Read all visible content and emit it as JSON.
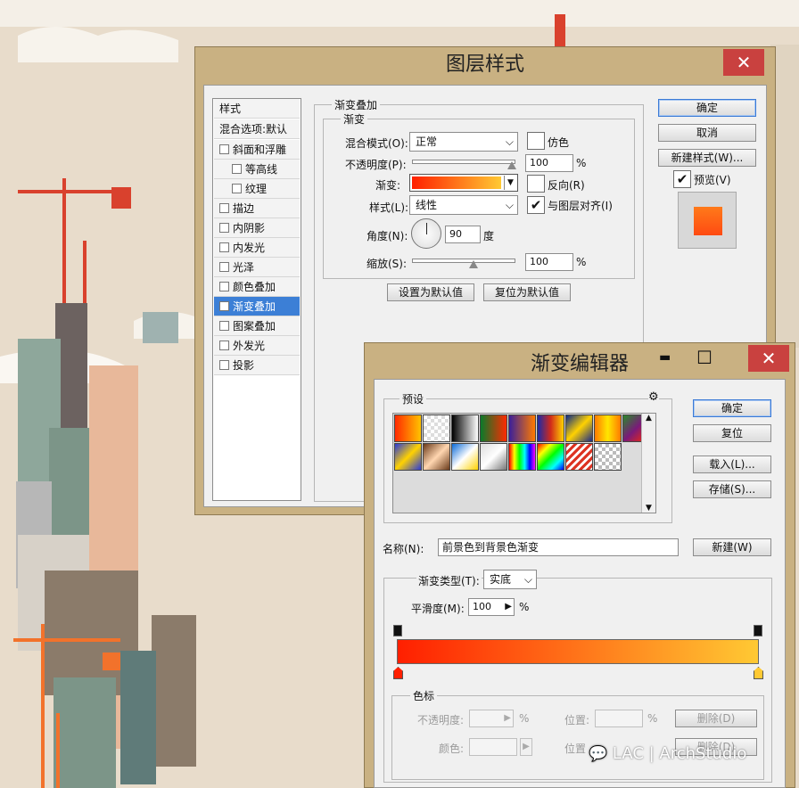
{
  "layer_style": {
    "title": "图层样式",
    "close": "✕",
    "styles_header": "样式",
    "blend_options": "混合选项:默认",
    "items": [
      {
        "label": "斜面和浮雕",
        "checked": false,
        "indent": false
      },
      {
        "label": "等高线",
        "checked": false,
        "indent": true
      },
      {
        "label": "纹理",
        "checked": false,
        "indent": true
      },
      {
        "label": "描边",
        "checked": false,
        "indent": false
      },
      {
        "label": "内阴影",
        "checked": false,
        "indent": false
      },
      {
        "label": "内发光",
        "checked": false,
        "indent": false
      },
      {
        "label": "光泽",
        "checked": false,
        "indent": false
      },
      {
        "label": "颜色叠加",
        "checked": false,
        "indent": false
      },
      {
        "label": "渐变叠加",
        "checked": true,
        "indent": false,
        "selected": true
      },
      {
        "label": "图案叠加",
        "checked": false,
        "indent": false
      },
      {
        "label": "外发光",
        "checked": false,
        "indent": false
      },
      {
        "label": "投影",
        "checked": false,
        "indent": false
      }
    ],
    "section_title": "渐变叠加",
    "group_title": "渐变",
    "blend_mode_label": "混合模式(O):",
    "blend_mode_value": "正常",
    "dither_label": "仿色",
    "opacity_label": "不透明度(P):",
    "opacity_value": "100",
    "opacity_unit": "%",
    "opacity_level": 1.0,
    "gradient_label": "渐变:",
    "reverse_label": "反向(R)",
    "style_label": "样式(L):",
    "style_value": "线性",
    "align_label": "与图层对齐(I)",
    "angle_label": "角度(N):",
    "angle_value": "90",
    "angle_unit": "度",
    "scale_label": "缩放(S):",
    "scale_value": "100",
    "scale_unit": "%",
    "scale_level": 0.6,
    "set_default": "设置为默认值",
    "reset_default": "复位为默认值",
    "ok": "确定",
    "cancel": "取消",
    "new_style": "新建样式(W)...",
    "preview_label": "预览(V)"
  },
  "gradient_editor": {
    "title": "渐变编辑器",
    "minimize": "▬",
    "maximize": "☐",
    "close": "✕",
    "presets_label": "预设",
    "gear": "⚙",
    "ok": "确定",
    "reset": "复位",
    "load": "载入(L)...",
    "save": "存储(S)...",
    "name_label": "名称(N):",
    "name_value": "前景色到背景色渐变",
    "new": "新建(W)",
    "type_label": "渐变类型(T):",
    "type_value": "实底",
    "smooth_label": "平滑度(M):",
    "smooth_value": "100",
    "smooth_unit": "%",
    "stops_title": "色标",
    "stop_opacity_label": "不透明度:",
    "stop_percent": "%",
    "location_label": "位置:",
    "delete_label": "删除(D)",
    "color_label": "颜色:",
    "location_label2": "位置",
    "delete_label2": "删除(D)",
    "colors": {
      "start": "#ff1f00",
      "end": "#ffc933"
    }
  },
  "watermark": "LAC | ArchStudio"
}
